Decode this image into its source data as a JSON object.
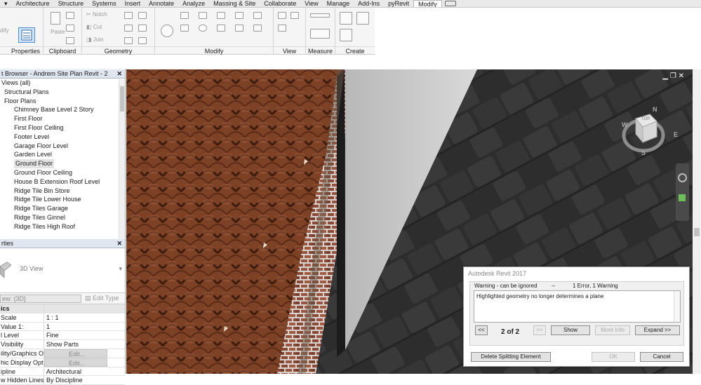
{
  "menu": {
    "tabs": [
      "Architecture",
      "Structure",
      "Systems",
      "Insert",
      "Annotate",
      "Analyze",
      "Massing & Site",
      "Collaborate",
      "View",
      "Manage",
      "Add-Ins",
      "pyRevit",
      "Modify"
    ],
    "active": "Modify"
  },
  "ribbon": {
    "panels": {
      "properties": "Properties",
      "clipboard": "Clipboard",
      "geometry": "Geometry",
      "modify": "Modify",
      "view": "View",
      "measure": "Measure",
      "create": "Create"
    },
    "tools": {
      "paste": "Paste",
      "notch": "Notch",
      "cut": "Cut",
      "join": "Join",
      "modify_left": "dify"
    }
  },
  "browser": {
    "title": "t Browser - Andrem Site Plan Revit - 2",
    "items": [
      {
        "label": "Views (all)",
        "indent": 0
      },
      {
        "label": "Structural Plans",
        "indent": 1
      },
      {
        "label": "Floor Plans",
        "indent": 1
      },
      {
        "label": "Chimney Base Level 2 Story",
        "indent": 2
      },
      {
        "label": "First Floor",
        "indent": 2
      },
      {
        "label": "First Floor Ceiling",
        "indent": 2
      },
      {
        "label": "Footer Level",
        "indent": 2
      },
      {
        "label": "Garage Floor Level",
        "indent": 2
      },
      {
        "label": "Garden Level",
        "indent": 2
      },
      {
        "label": "Ground Floor",
        "indent": 2,
        "selected": true
      },
      {
        "label": "Ground Floor Ceiling",
        "indent": 2
      },
      {
        "label": "House B Extension Roof Level",
        "indent": 2
      },
      {
        "label": "Ridge Tile Bin Store",
        "indent": 2
      },
      {
        "label": "Ridge Tile Lower House",
        "indent": 2
      },
      {
        "label": "Ridge Tiles Garage",
        "indent": 2
      },
      {
        "label": "Ridge Tiles Ginnel",
        "indent": 2
      },
      {
        "label": "Ridge Tiles High Roof",
        "indent": 2
      }
    ]
  },
  "properties": {
    "title": "rties",
    "type_name": "3D View",
    "filter": "ew: {3D}",
    "edit_type": "Edit Type",
    "rows": [
      {
        "k": "ics",
        "v": "",
        "hdr": true
      },
      {
        "k": "Scale",
        "v": "1 : 1"
      },
      {
        "k": "Value   1:",
        "v": "1"
      },
      {
        "k": "l Level",
        "v": "Fine"
      },
      {
        "k": " Visibility",
        "v": "Show Parts"
      },
      {
        "k": "ility/Graphics O...",
        "v": "Edit...",
        "btn": true
      },
      {
        "k": "hic Display Opti...",
        "v": "Edit...",
        "btn": true
      },
      {
        "k": "ipline",
        "v": "Architectural"
      },
      {
        "k": "w Hidden Lines",
        "v": "By Discipline"
      }
    ]
  },
  "dialog": {
    "title": "Autodesk Revit 2017",
    "severity": "Warning - can be ignored",
    "dash": "--",
    "summary": "1 Error, 1 Warning",
    "message": "Highlighted geometry no longer determines a plane",
    "prev": "<<",
    "page": "2 of 2",
    "next": ">>",
    "show": "Show",
    "more_info": "More Info",
    "expand": "Expand >>",
    "delete_btn": "Delete Splitting Element",
    "ok": "OK",
    "cancel": "Cancel"
  },
  "viewcube": {
    "n": "N",
    "s": "S",
    "e": "E",
    "w": "W",
    "face": "TOP"
  }
}
